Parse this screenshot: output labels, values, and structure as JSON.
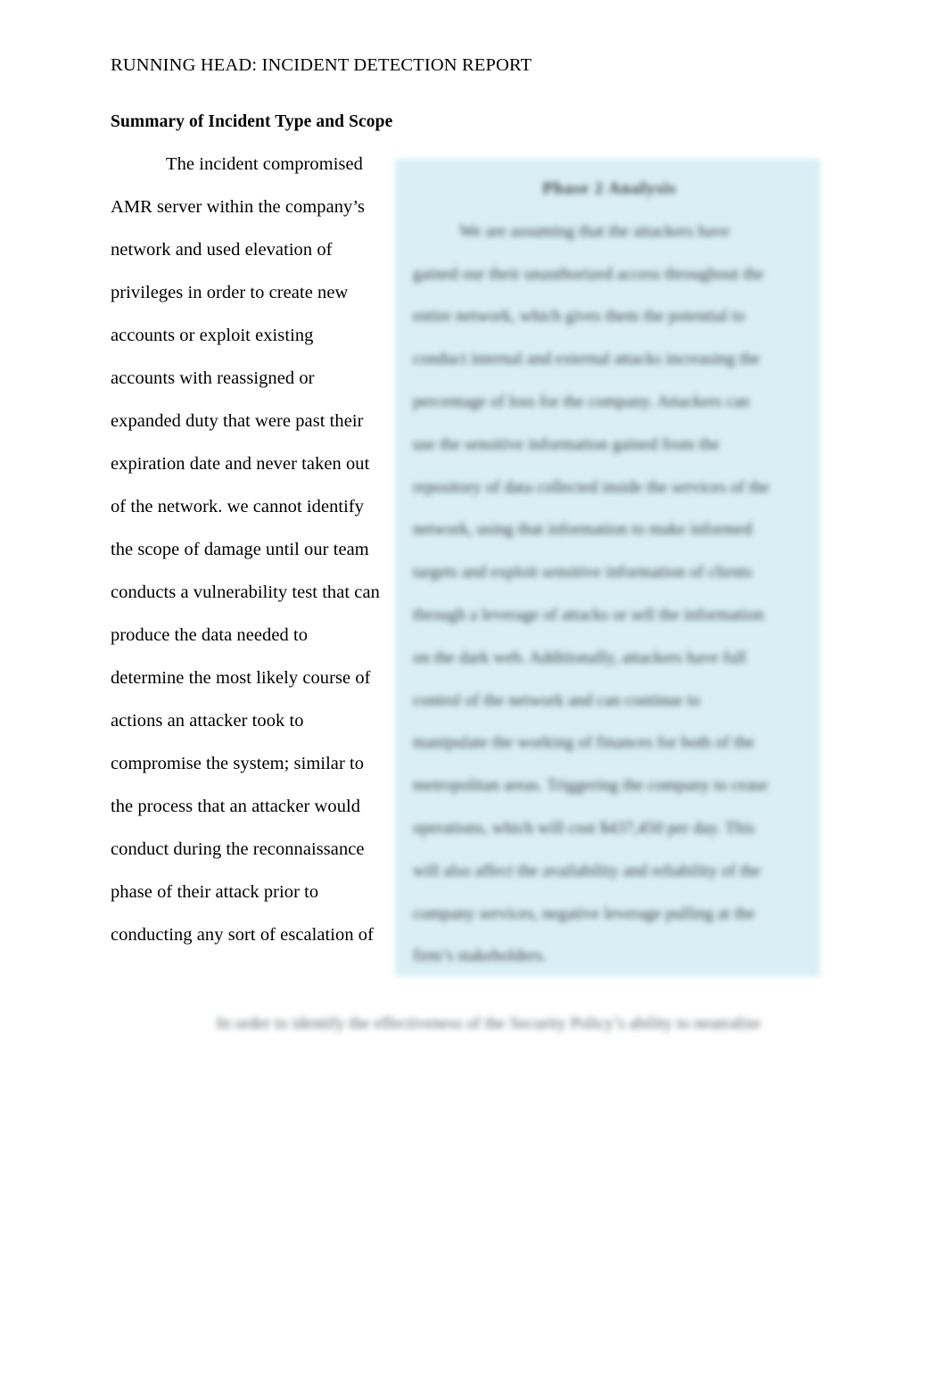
{
  "document": {
    "running_head": "RUNNING HEAD: INCIDENT DETECTION REPORT",
    "section_heading": "Summary of Incident Type and Scope",
    "page_background": "#ffffff",
    "text_color": "#000000"
  },
  "body": {
    "lines": [
      "The incident compromised",
      "AMR server within the company’s",
      "network and used elevation of",
      "privileges in order to create new",
      "accounts or exploit existing",
      "accounts with reassigned or",
      "expanded duty that were past their",
      "expiration date and never taken out",
      "of the network. we cannot identify",
      "the scope of damage until our team",
      "conducts a vulnerability test that can",
      "produce the data needed to",
      "determine the most likely course of",
      "actions an attacker took to",
      "compromise the system; similar to",
      "the process that an attacker would",
      "conduct during the reconnaissance",
      "phase of their attack prior to",
      "conducting any sort of escalation of"
    ]
  },
  "figure_box": {
    "background_color": "#d9eff5",
    "redacted": true,
    "title": "Phase 2      Analysis",
    "lines": [
      "We are assuming that the attackers have",
      "gained our their unauthorized access throughout the",
      "entire network, which gives them the potential to",
      "conduct internal and external attacks increasing the",
      "percentage of loss for the company.  Attackers can",
      "use the sensitive information gained from the",
      "repository of data collected inside the services of the",
      "network, using that information to make informed",
      "targets and exploit sensitive information of clients",
      "through a leverage of attacks or sell the information",
      "on the dark web.  Additionally, attackers have full",
      "control of the network and can continue to",
      "manipulate the working of finances for both of the",
      "metropolitan areas. Triggering the company to cease",
      "operations, which will cost $437,450 per day. This",
      "will also affect the availability and reliability of the",
      "company services, negative leverage pulling at the",
      "firm’s stakeholders."
    ]
  },
  "caption": {
    "redacted": true,
    "text": "In order to identify the effectiveness of the Security Policy’s ability to neutralize"
  }
}
